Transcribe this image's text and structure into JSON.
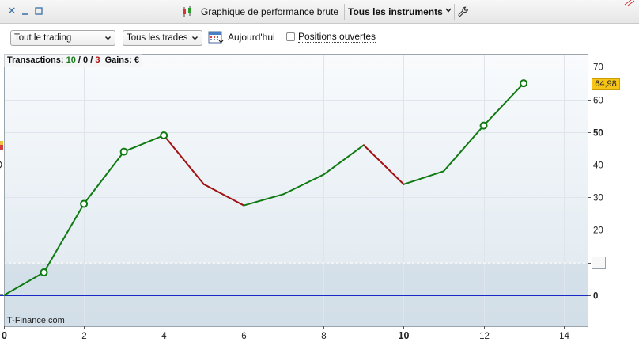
{
  "titlebar": {
    "title": "Graphique de performance brute",
    "instrument_label": "Tous les instruments",
    "close_glyph": "✕",
    "icons": [
      "close-icon",
      "minimize-icon",
      "maximize-icon",
      "candlestick-icon",
      "chevron-down-icon",
      "wrench-icon"
    ]
  },
  "toolbar": {
    "trading_select": "Tout le trading",
    "trades_select": "Tous les trades",
    "today_label": "Aujourd'hui",
    "open_positions_label": "Positions ouvertes",
    "open_positions_checked": false
  },
  "stats": {
    "transactions_label": "Transactions:",
    "wins": "10",
    "sep1": " / ",
    "neutral": "0",
    "sep2": " / ",
    "losses": "3",
    "gains_label": "Gains: €"
  },
  "brand": "IT-Finance.com",
  "last_value_tag": "64,98",
  "colors": {
    "up": "#0f7a12",
    "down": "#a01010",
    "zero_line": "#1a28c8",
    "background_top": "#f7fafc",
    "background_bottom": "#dde7ee"
  },
  "chart_data": {
    "type": "line",
    "x": [
      0,
      1,
      2,
      3,
      4,
      5,
      6,
      7,
      8,
      9,
      10,
      11,
      12,
      13
    ],
    "y": [
      0,
      7,
      28,
      44,
      49,
      34,
      27.5,
      31,
      37,
      46,
      34,
      38,
      52,
      64.98
    ],
    "markers": [
      false,
      true,
      true,
      true,
      true,
      false,
      false,
      false,
      false,
      false,
      false,
      false,
      true,
      true
    ],
    "xlim": [
      0,
      14.6
    ],
    "ylim": [
      -9.5,
      74
    ],
    "x_ticks": [
      0,
      2,
      4,
      6,
      8,
      10,
      12,
      14
    ],
    "x_ticks_bold": [
      0,
      10
    ],
    "y_ticks": [
      0,
      10,
      20,
      30,
      40,
      50,
      60,
      70
    ],
    "y_ticks_bold": [
      0,
      50
    ],
    "grid": true,
    "legend": "none"
  }
}
